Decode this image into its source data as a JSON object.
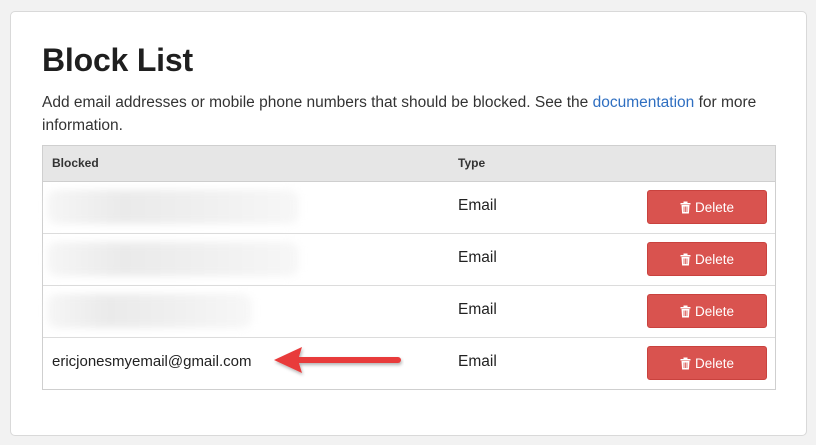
{
  "page": {
    "title": "Block List",
    "description_before_link": "Add email addresses or mobile phone numbers that should be blocked. See the ",
    "description_link": "documentation",
    "description_after_link": " for more information."
  },
  "table": {
    "headers": {
      "blocked": "Blocked",
      "type": "Type"
    },
    "rows": [
      {
        "blocked": "",
        "redacted": true,
        "type": "Email",
        "action": "Delete"
      },
      {
        "blocked": "",
        "redacted": true,
        "type": "Email",
        "action": "Delete"
      },
      {
        "blocked": "",
        "redacted": true,
        "type": "Email",
        "action": "Delete"
      },
      {
        "blocked": "ericjonesmyemail@gmail.com",
        "redacted": false,
        "type": "Email",
        "action": "Delete"
      }
    ]
  },
  "icons": {
    "delete": "trash-icon",
    "annotation": "red-arrow-annotation"
  },
  "colors": {
    "delete_button": "#d9534f",
    "link": "#2f6fc1",
    "header_bg": "#e6e6e6",
    "annotation_arrow": "#e83a3a"
  }
}
